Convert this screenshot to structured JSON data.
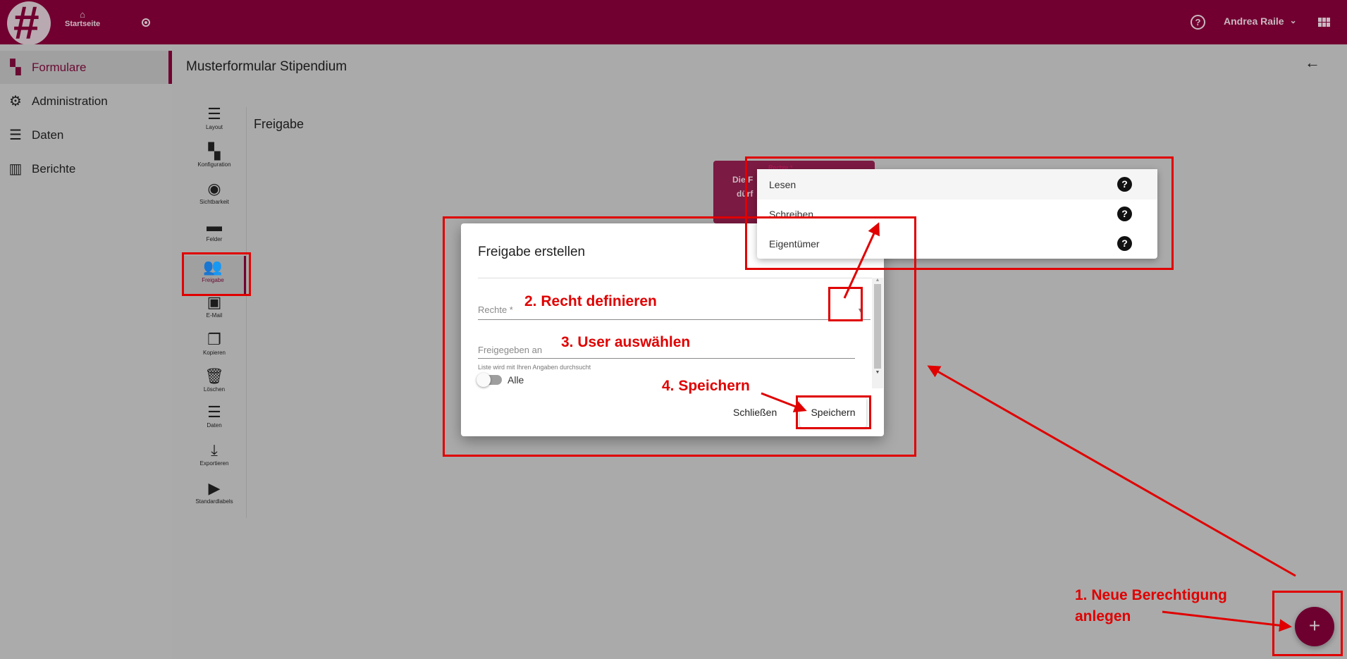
{
  "header": {
    "home_label": "Startseite",
    "user_name": "Andrea Raile",
    "brand_color": "#710030"
  },
  "sidebar": {
    "items": [
      {
        "label": "Formulare",
        "icon": "dashboard-icon",
        "selected": true
      },
      {
        "label": "Administration",
        "icon": "gear-icon"
      },
      {
        "label": "Daten",
        "icon": "storage-icon"
      },
      {
        "label": "Berichte",
        "icon": "bar-chart-icon"
      }
    ]
  },
  "main": {
    "title": "Musterformular Stipendium",
    "section_title": "Freigabe",
    "subnav": [
      {
        "label": "Layout",
        "icon": "storage-icon"
      },
      {
        "label": "Konfiguration",
        "icon": "dashboard-icon"
      },
      {
        "label": "Sichtbarkeit",
        "icon": "eye-icon"
      },
      {
        "label": "Felder",
        "icon": "fields-icon"
      },
      {
        "label": "Freigabe",
        "icon": "people-icon",
        "selected": true
      },
      {
        "label": "E-Mail",
        "icon": "contact-mail-icon"
      },
      {
        "label": "Kopieren",
        "icon": "copy-icon"
      },
      {
        "label": "Löschen",
        "icon": "trash-icon"
      },
      {
        "label": "Daten",
        "icon": "storage-icon"
      },
      {
        "label": "Exportieren",
        "icon": "download-icon"
      },
      {
        "label": "Standardlabels",
        "icon": "label-icon"
      }
    ],
    "card_text_partial": [
      "Die F",
      "dürf"
    ]
  },
  "dialog": {
    "title": "Freigabe erstellen",
    "rights_label": "Rechte *",
    "shared_with_label": "Freigegeben an",
    "hint": "Liste wird mit Ihren Angaben durchsucht",
    "toggle_label": "Alle",
    "toggle_on": false,
    "close_label": "Schließen",
    "save_label": "Speichern"
  },
  "dropdown": {
    "floating_label": "Rechte *",
    "options": [
      {
        "label": "Lesen",
        "highlighted": true
      },
      {
        "label": "Schreiben"
      },
      {
        "label": "Eigentümer"
      }
    ]
  },
  "annotations": {
    "step1_line1": "1. Neue Berechtigung",
    "step1_line2": "anlegen",
    "step2": "2. Recht definieren",
    "step3": "3. User auswählen",
    "step4": "4. Speichern",
    "color": "#e00000"
  }
}
